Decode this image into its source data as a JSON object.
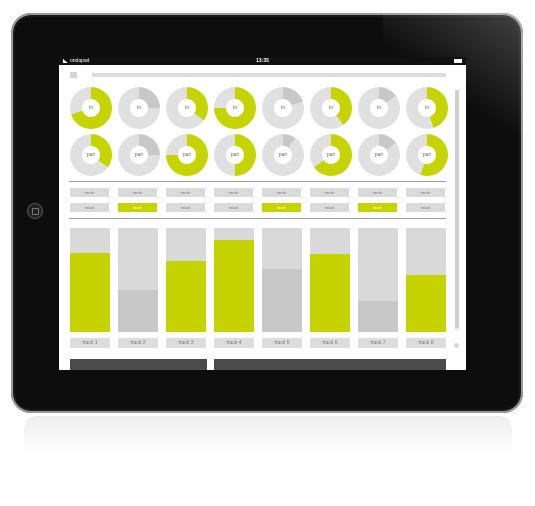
{
  "status_bar": {
    "carrier": "ondapad",
    "time": "13:35"
  },
  "colors": {
    "accent": "#c5d400",
    "idle": "#c8c8c8",
    "track": "#e0e0e0",
    "fader_bg": "#d9d9d9"
  },
  "knobs": {
    "row1": [
      {
        "label": "lo",
        "value": 0.7,
        "active": true
      },
      {
        "label": "lo",
        "value": 0.25,
        "active": false
      },
      {
        "label": "lo",
        "value": 0.35,
        "active": true
      },
      {
        "label": "lo",
        "value": 0.75,
        "active": true
      },
      {
        "label": "lo",
        "value": 0.2,
        "active": false
      },
      {
        "label": "lo",
        "value": 0.4,
        "active": true
      },
      {
        "label": "lo",
        "value": 0.15,
        "active": false
      },
      {
        "label": "lo",
        "value": 0.45,
        "active": true
      }
    ],
    "row2": [
      {
        "label": "pan",
        "value": 0.35,
        "active": true
      },
      {
        "label": "pan",
        "value": 0.25,
        "active": false
      },
      {
        "label": "pan",
        "value": 0.75,
        "active": true
      },
      {
        "label": "pan",
        "value": 0.5,
        "active": true
      },
      {
        "label": "pan",
        "value": 0.1,
        "active": false
      },
      {
        "label": "pan",
        "value": 0.65,
        "active": true
      },
      {
        "label": "pan",
        "value": 0.15,
        "active": false
      },
      {
        "label": "pan",
        "value": 0.55,
        "active": true
      }
    ]
  },
  "mute_row": [
    "mute",
    "mute",
    "mute",
    "mute",
    "mute",
    "mute",
    "mute",
    "mute"
  ],
  "solo_row": [
    {
      "label": "mute",
      "active": false
    },
    {
      "label": "mute",
      "active": true
    },
    {
      "label": "mute",
      "active": false
    },
    {
      "label": "mute",
      "active": false
    },
    {
      "label": "mute",
      "active": true
    },
    {
      "label": "mute",
      "active": false
    },
    {
      "label": "mute",
      "active": true
    },
    {
      "label": "mute",
      "active": false
    }
  ],
  "faders": [
    {
      "level": 0.76,
      "active": true
    },
    {
      "level": 0.4,
      "active": false
    },
    {
      "level": 0.68,
      "active": true
    },
    {
      "level": 0.88,
      "active": true
    },
    {
      "level": 0.61,
      "active": false
    },
    {
      "level": 0.75,
      "active": true
    },
    {
      "level": 0.3,
      "active": false
    },
    {
      "level": 0.55,
      "active": true
    }
  ],
  "tracks": [
    "track 1",
    "track 2",
    "track 3",
    "track 4",
    "track 5",
    "track 6",
    "track 7",
    "track 8"
  ]
}
